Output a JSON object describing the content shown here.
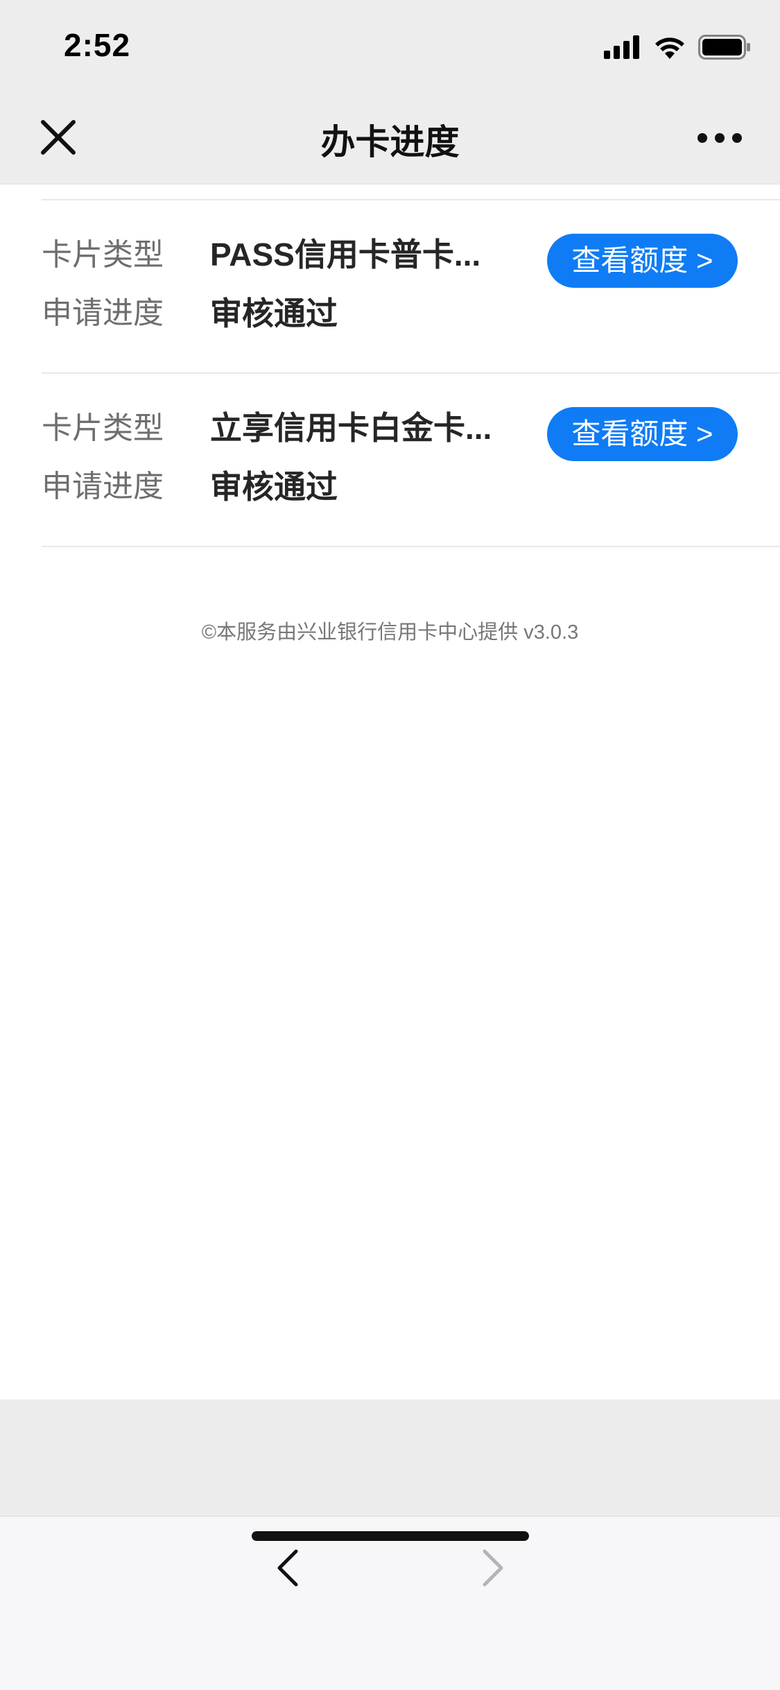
{
  "status_bar": {
    "time": "2:52"
  },
  "nav": {
    "title": "办卡进度"
  },
  "cards": [
    {
      "type_label": "卡片类型",
      "type_value": "PASS信用卡普卡...",
      "progress_label": "申请进度",
      "progress_value": "审核通过",
      "button_label": "查看额度 >"
    },
    {
      "type_label": "卡片类型",
      "type_value": "立享信用卡白金卡...",
      "progress_label": "申请进度",
      "progress_value": "审核通过",
      "button_label": "查看额度 >"
    }
  ],
  "footer": {
    "note": "©本服务由兴业银行信用卡中心提供 v3.0.3"
  },
  "colors": {
    "accent": "#0f7cf5",
    "nav_bg": "#ededed"
  },
  "icons": {
    "close": "close-icon",
    "more": "more-icon",
    "back": "chevron-left-icon",
    "forward": "chevron-right-icon"
  }
}
